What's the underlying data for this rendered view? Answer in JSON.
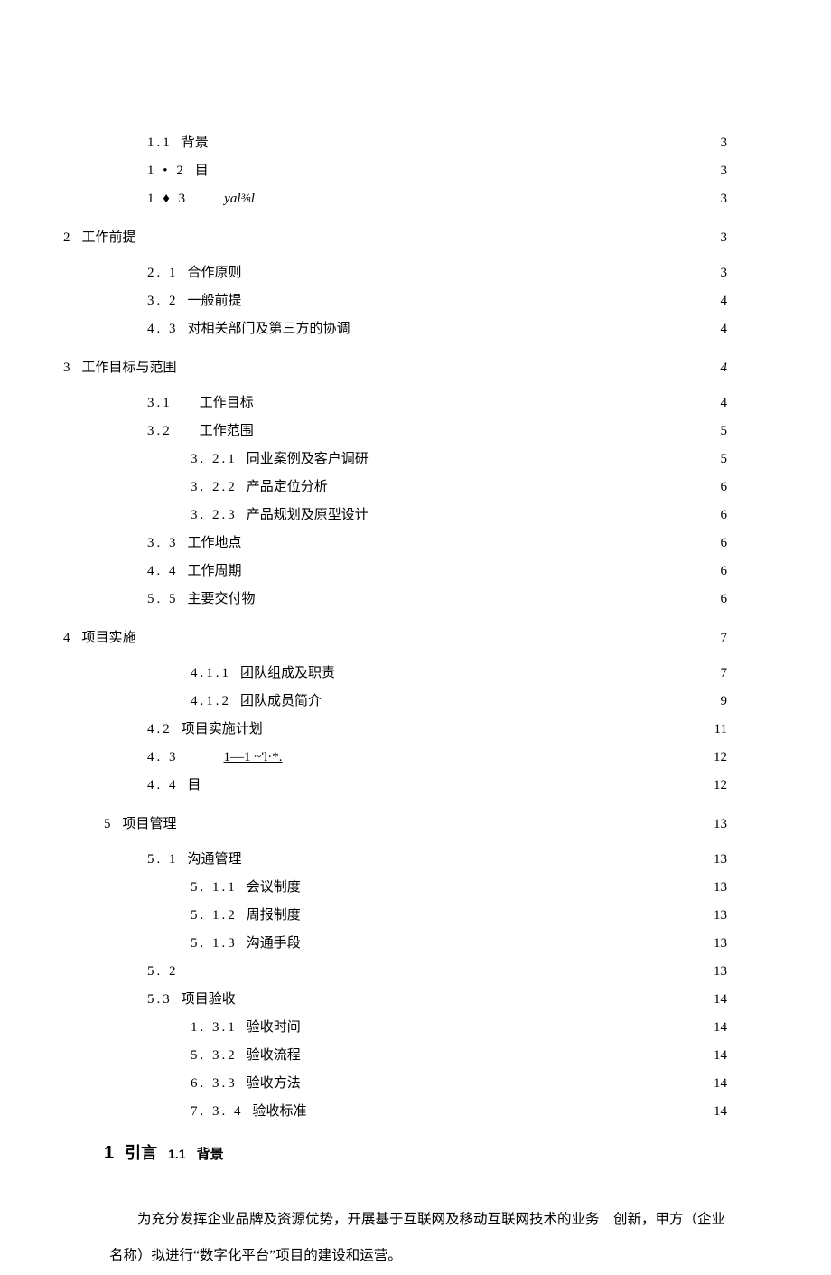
{
  "toc": {
    "s1_1": {
      "num": "1.1",
      "label": "背景",
      "page": "3"
    },
    "s1_2": {
      "num": "1 • 2",
      "label": "目",
      "page": "3"
    },
    "s1_3": {
      "num": "1  ♦ 3",
      "label": "yal⅜l",
      "page": "3"
    },
    "s2": {
      "num": "2",
      "label": "工作前提",
      "page": "3"
    },
    "s2_1": {
      "num": "2.  1",
      "label": "合作原则",
      "page": "3"
    },
    "s2_2": {
      "num": "3.  2",
      "label": "一般前提",
      "page": "4"
    },
    "s2_3": {
      "num": "4.  3",
      "label": "对相关部门及第三方的协调",
      "page": "4"
    },
    "s3": {
      "num": "3",
      "label": "工作目标与范围",
      "page": "4"
    },
    "s3_1": {
      "num": "3.1",
      "label": "工作目标",
      "page": "4"
    },
    "s3_2": {
      "num": "3.2",
      "label": "工作范围",
      "page": "5"
    },
    "s321": {
      "num": "3. 2.1",
      "label": "同业案例及客户调研",
      "page": "5"
    },
    "s322": {
      "num": "3. 2.2",
      "label": "产品定位分析",
      "page": "6"
    },
    "s323": {
      "num": "3. 2.3",
      "label": "产品规划及原型设计",
      "page": "6"
    },
    "s3_3": {
      "num": "3.  3",
      "label": "工作地点",
      "page": "6"
    },
    "s3_4": {
      "num": "4.  4",
      "label": "工作周期",
      "page": "6"
    },
    "s3_5": {
      "num": "5.  5",
      "label": "主要交付物",
      "page": "6"
    },
    "s4": {
      "num": "4",
      "label": "项目实施",
      "page": "7"
    },
    "s411": {
      "num": "4.1.1",
      "label": "团队组成及职责",
      "page": "7"
    },
    "s412": {
      "num": "4.1.2",
      "label": "团队成员简介",
      "page": "9"
    },
    "s4_2": {
      "num": "4.2",
      "label": "项目实施计划",
      "page": "11"
    },
    "s4_3": {
      "num": "4. 3",
      "label": "1—1 ~'l·*.",
      "page": "12"
    },
    "s4_4": {
      "num": "4. 4",
      "label": "目",
      "page": "12"
    },
    "s5": {
      "num": "5",
      "label": "项目管理",
      "page": "13"
    },
    "s5_1": {
      "num": "5. 1",
      "label": "沟通管理",
      "page": "13"
    },
    "s511": {
      "num": "5. 1.1",
      "label": "会议制度",
      "page": "13"
    },
    "s512": {
      "num": "5. 1.2",
      "label": "周报制度",
      "page": "13"
    },
    "s513": {
      "num": "5. 1.3",
      "label": "沟通手段",
      "page": "13"
    },
    "s5_2": {
      "num": "5. 2",
      "label": "",
      "page": "13"
    },
    "s5_3": {
      "num": "5.3",
      "label": "项目验收",
      "page": "14"
    },
    "s531": {
      "num": "1.  3.1",
      "label": "验收时间",
      "page": "14"
    },
    "s532": {
      "num": "5.  3.2",
      "label": "验收流程",
      "page": "14"
    },
    "s533": {
      "num": "6.  3.3",
      "label": "验收方法",
      "page": "14"
    },
    "s534": {
      "num": "7.  3. 4",
      "label": "验收标准",
      "page": "14"
    }
  },
  "heading": {
    "h1_num": "1",
    "h1_cn": "引言",
    "h2_num": "1.1",
    "h2_cn": "背景"
  },
  "body": "为充分发挥企业品牌及资源优势，开展基于互联网及移动互联网技术的业务　创新，甲方（企业名称）拟进行“数字化平台”项目的建设和运营。"
}
